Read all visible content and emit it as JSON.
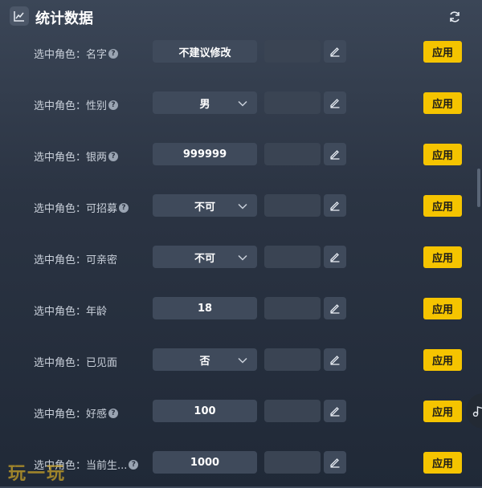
{
  "header": {
    "title": "统计数据",
    "icon": "line-chart-icon",
    "refresh_icon": "refresh-icon"
  },
  "rows": [
    {
      "label": "选中角色：名字",
      "help": true,
      "value": "不建议修改",
      "kind": "text",
      "apply": "应用"
    },
    {
      "label": "选中角色：性别",
      "help": true,
      "value": "男",
      "kind": "select",
      "apply": "应用"
    },
    {
      "label": "选中角色：银两",
      "help": true,
      "value": "999999",
      "kind": "text",
      "apply": "应用"
    },
    {
      "label": "选中角色：可招募",
      "help": true,
      "value": "不可",
      "kind": "select",
      "apply": "应用"
    },
    {
      "label": "选中角色：可亲密",
      "help": false,
      "value": "不可",
      "kind": "select",
      "apply": "应用"
    },
    {
      "label": "选中角色：年龄",
      "help": false,
      "value": "18",
      "kind": "text",
      "apply": "应用"
    },
    {
      "label": "选中角色：已见面",
      "help": false,
      "value": "否",
      "kind": "select",
      "apply": "应用"
    },
    {
      "label": "选中角色：好感",
      "help": true,
      "value": "100",
      "kind": "text",
      "apply": "应用"
    },
    {
      "label": "选中角色：当前生...",
      "help": true,
      "value": "1000",
      "kind": "text",
      "apply": "应用"
    }
  ],
  "help_glyph": "?",
  "watermark": "玩一玩",
  "colors": {
    "accent": "#f5c400",
    "field": "#3f4a5b"
  }
}
